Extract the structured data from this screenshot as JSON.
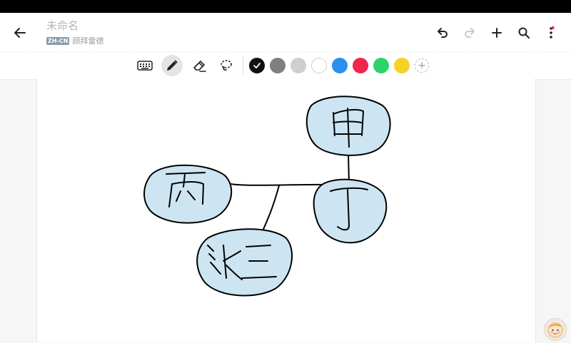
{
  "header": {
    "title": "未命名",
    "lang_badge": "ZH-CN",
    "subtitle": "顾拜雷德"
  },
  "header_icons": [
    "back-arrow-icon",
    "undo-icon",
    "redo-icon",
    "add-icon",
    "search-icon",
    "more-icon"
  ],
  "toolbar": {
    "tools": [
      "keyboard-icon",
      "pen-icon",
      "eraser-icon",
      "lasso-icon"
    ],
    "active_tool": "pen-icon",
    "colors": [
      "#111111",
      "#7f7f7f",
      "#cfcfcf",
      "#ffffff",
      "#2b8ff0",
      "#f0264a",
      "#2dd26a",
      "#f7d12a"
    ],
    "selected_color": "#111111"
  },
  "canvas": {
    "nodes": [
      {
        "id": "node-jia",
        "text": "甲"
      },
      {
        "id": "node-bing",
        "text": "丙"
      },
      {
        "id": "node-ding",
        "text": "丁"
      },
      {
        "id": "node-zhangsan",
        "text": "张三"
      }
    ],
    "fill_color": "#cde5f2"
  }
}
